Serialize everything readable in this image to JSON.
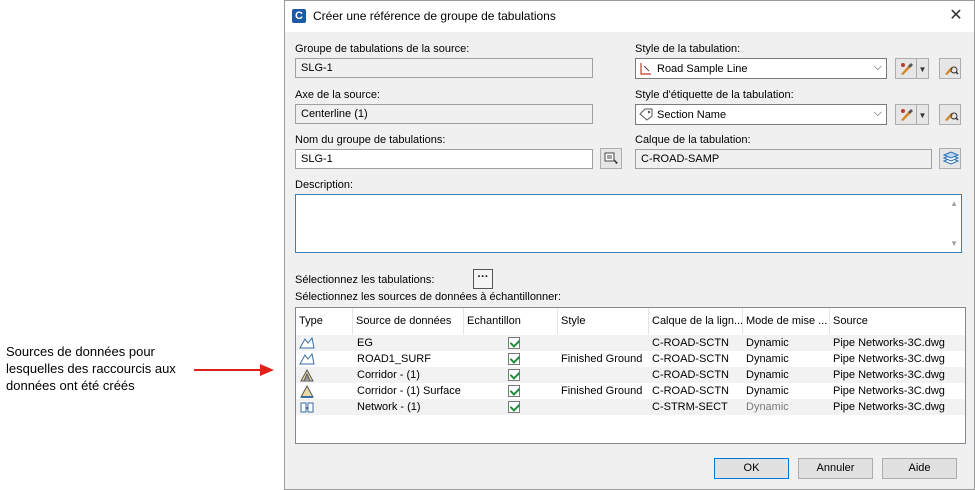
{
  "annotation": {
    "text": "Sources de données pour lesquelles des raccourcis aux données ont été créés"
  },
  "dialog": {
    "title": "Créer une référence de groupe de tabulations",
    "close_glyph": "✕",
    "source_group": {
      "label": "Groupe de tabulations de la source:",
      "value": "SLG-1"
    },
    "source_axis": {
      "label": "Axe de la source:",
      "value": "Centerline (1)"
    },
    "group_name": {
      "label": "Nom du groupe de tabulations:",
      "value": "SLG-1"
    },
    "sample_style": {
      "label": "Style de la tabulation:",
      "value": "Road Sample Line"
    },
    "label_style": {
      "label": "Style d'étiquette de la tabulation:",
      "value": "Section Name"
    },
    "layer": {
      "label": "Calque de la tabulation:",
      "value": "C-ROAD-SAMP"
    },
    "description": {
      "label": "Description:",
      "value": ""
    },
    "select_samples_label": "Sélectionnez les tabulations:",
    "select_sources_label": "Sélectionnez les sources de données à échantillonner:",
    "ellipsis": "···",
    "table": {
      "headers": [
        "Type",
        "Source de données",
        "Echantillon",
        "Style",
        "Calque de la lign...",
        "Mode de mise ...",
        "Source"
      ],
      "rows": [
        {
          "source": "EG",
          "checked": true,
          "style": "",
          "layer": "C-ROAD-SCTN",
          "mode": "Dynamic",
          "origin": "Pipe Networks-3C.dwg",
          "type_icon": "surface-icon",
          "mode_dim": false
        },
        {
          "source": "ROAD1_SURF",
          "checked": true,
          "style": "Finished Ground",
          "layer": "C-ROAD-SCTN",
          "mode": "Dynamic",
          "origin": "Pipe Networks-3C.dwg",
          "type_icon": "surface-icon",
          "mode_dim": false
        },
        {
          "source": "Corridor - (1)",
          "checked": true,
          "style": "",
          "layer": "C-ROAD-SCTN",
          "mode": "Dynamic",
          "origin": "Pipe Networks-3C.dwg",
          "type_icon": "corridor-icon",
          "mode_dim": false
        },
        {
          "source": "Corridor - (1) Surface",
          "checked": true,
          "style": "Finished Ground",
          "layer": "C-ROAD-SCTN",
          "mode": "Dynamic",
          "origin": "Pipe Networks-3C.dwg",
          "type_icon": "corridor-surface-icon",
          "mode_dim": false
        },
        {
          "source": "Network - (1)",
          "checked": true,
          "style": "",
          "layer": "C-STRM-SECT",
          "mode": "Dynamic",
          "origin": "Pipe Networks-3C.dwg",
          "type_icon": "pipe-network-icon",
          "mode_dim": true
        }
      ]
    },
    "buttons": {
      "ok": "OK",
      "cancel": "Annuler",
      "help": "Aide"
    }
  },
  "colors": {
    "arrow": "#e0201b",
    "accent": "#0078d7",
    "check": "#1f8e3d"
  }
}
